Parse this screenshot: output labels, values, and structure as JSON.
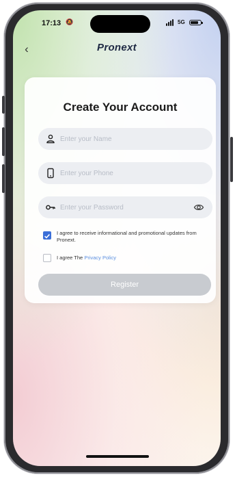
{
  "status_bar": {
    "time": "17:13",
    "network": "5G"
  },
  "header": {
    "brand": "Pronext",
    "back_icon": "chevron-left-icon"
  },
  "form": {
    "title": "Create Your Account",
    "name_placeholder": "Enter your Name",
    "phone_placeholder": "Enter your Phone",
    "password_placeholder": "Enter your Password",
    "consent_marketing": {
      "text": "I agree to receive informational and promotional updates from Pronext.",
      "checked": true
    },
    "consent_policy": {
      "prefix": "I agree The ",
      "link": "Privacy Policy",
      "checked": false
    },
    "register_label": "Register"
  },
  "colors": {
    "accent": "#3b6fd8",
    "link": "#5b8fe0",
    "button_disabled": "#c8cbd0",
    "input_bg": "#eceef2"
  }
}
